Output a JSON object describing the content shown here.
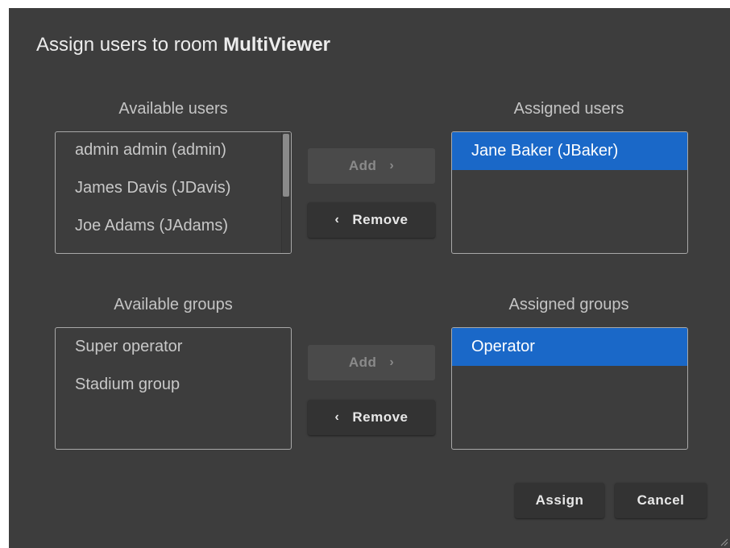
{
  "dialog": {
    "title_prefix": "Assign users to room ",
    "room_name": "MultiViewer"
  },
  "users": {
    "available_label": "Available users",
    "assigned_label": "Assigned users",
    "available": [
      "admin admin (admin)",
      "James Davis (JDavis)",
      "Joe Adams (JAdams)"
    ],
    "assigned": [
      "Jane Baker (JBaker)"
    ],
    "add_label": "Add",
    "remove_label": "Remove"
  },
  "groups": {
    "available_label": "Available groups",
    "assigned_label": "Assigned groups",
    "available": [
      "Super operator",
      "Stadium group"
    ],
    "assigned": [
      "Operator"
    ],
    "add_label": "Add",
    "remove_label": "Remove"
  },
  "footer": {
    "assign_label": "Assign",
    "cancel_label": "Cancel"
  },
  "icons": {
    "chevron_left": "‹",
    "chevron_right": "›"
  },
  "colors": {
    "dialog_bg": "#3d3d3d",
    "selected": "#1a68c8"
  }
}
